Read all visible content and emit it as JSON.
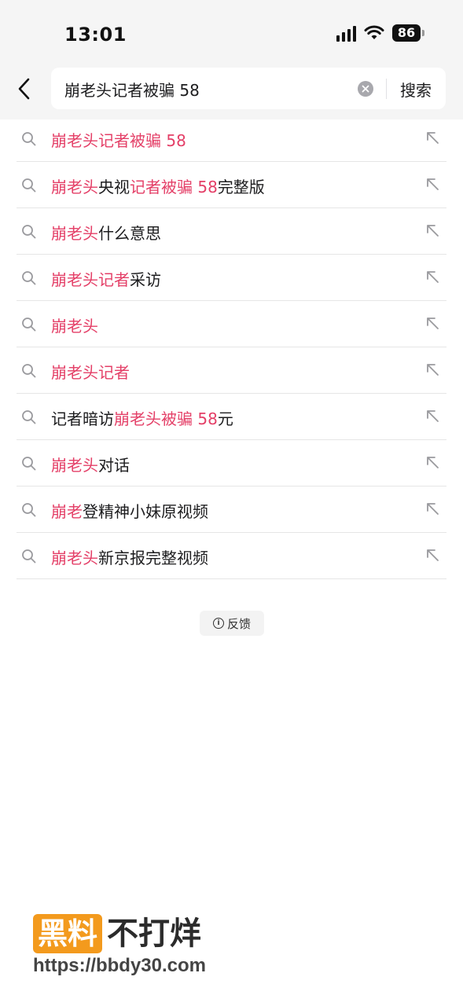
{
  "status_bar": {
    "time": "13:01",
    "battery": "86"
  },
  "search": {
    "query": "崩老头记者被骗 58",
    "submit_label": "搜索"
  },
  "suggestions": [
    {
      "parts": [
        {
          "t": "崩老头记者被骗 58",
          "h": true
        }
      ]
    },
    {
      "parts": [
        {
          "t": "崩老头",
          "h": true
        },
        {
          "t": "央视",
          "h": false
        },
        {
          "t": "记者被骗 58",
          "h": true
        },
        {
          "t": "完整版",
          "h": false
        }
      ]
    },
    {
      "parts": [
        {
          "t": "崩老头",
          "h": true
        },
        {
          "t": "什么意思",
          "h": false
        }
      ]
    },
    {
      "parts": [
        {
          "t": "崩老头记者",
          "h": true
        },
        {
          "t": "采访",
          "h": false
        }
      ]
    },
    {
      "parts": [
        {
          "t": "崩老头",
          "h": true
        }
      ]
    },
    {
      "parts": [
        {
          "t": "崩老头记者",
          "h": true
        }
      ]
    },
    {
      "parts": [
        {
          "t": "记者暗访",
          "h": false
        },
        {
          "t": "崩老头被骗 58",
          "h": true
        },
        {
          "t": "元",
          "h": false
        }
      ]
    },
    {
      "parts": [
        {
          "t": "崩老头",
          "h": true
        },
        {
          "t": "对话",
          "h": false
        }
      ]
    },
    {
      "parts": [
        {
          "t": "崩老",
          "h": true
        },
        {
          "t": "登精神小妹原视频",
          "h": false
        }
      ]
    },
    {
      "parts": [
        {
          "t": "崩老头",
          "h": true
        },
        {
          "t": "新京报完整视频",
          "h": false
        }
      ]
    }
  ],
  "feedback": {
    "label": "反馈"
  },
  "watermark": {
    "badge": "黑料",
    "title": "不打烊",
    "url": "https://bbdy30.com"
  },
  "colors": {
    "highlight": "#e43f67",
    "watermark_badge": "#f39a1d"
  },
  "icons": {
    "row_leading": "search-icon",
    "row_trailing": "fill-arrow-icon"
  }
}
